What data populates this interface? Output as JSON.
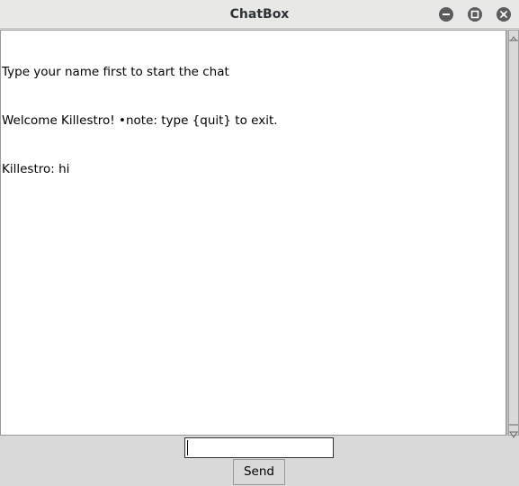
{
  "window": {
    "title": "ChatBox"
  },
  "chat": {
    "lines": [
      "Type your name first to start the chat",
      "Welcome Killestro! •note: type {quit} to exit.",
      "Killestro: hi"
    ]
  },
  "input": {
    "value": ""
  },
  "send_button": {
    "label": "Send"
  },
  "icons": {
    "minimize": "minimize-icon",
    "maximize": "maximize-icon",
    "close": "close-icon"
  }
}
